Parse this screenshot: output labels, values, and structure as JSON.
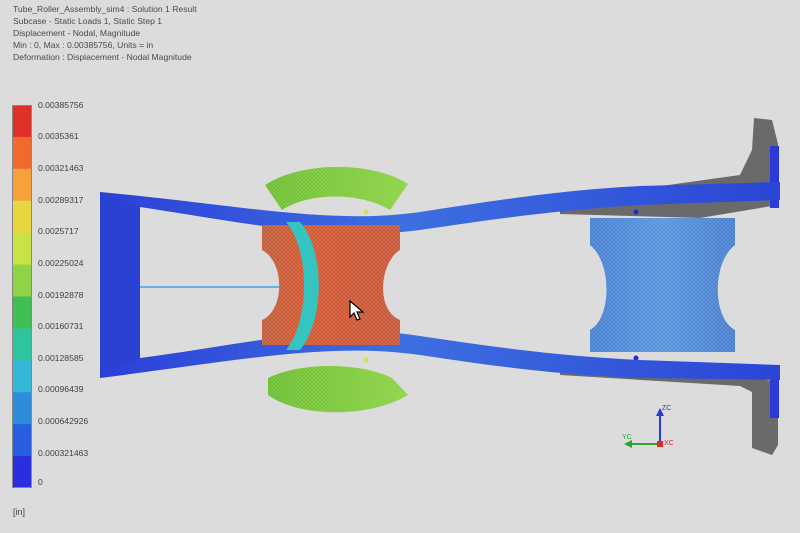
{
  "header": {
    "file_title": "Tube_Roller_Assembly_sim4 : Solution 1 Result",
    "subcase": "Subcase - Static Loads 1, Static Step 1",
    "result_type": "Displacement - Nodal, Magnitude",
    "range": "Min : 0, Max : 0.00385756, Units = in",
    "deformation": "Deformation : Displacement - Nodal Magnitude"
  },
  "legend": {
    "labels": [
      "0.00385756",
      "0.0035361",
      "0.00321463",
      "0.00289317",
      "0.0025717",
      "0.00225024",
      "0.00192878",
      "0.00160731",
      "0.00128585",
      "0.00096439",
      "0.000642926",
      "0.000321463",
      "0"
    ],
    "colors": [
      "#e0302a",
      "#ef6a2c",
      "#f6a23a",
      "#e8d640",
      "#c8e444",
      "#8ed446",
      "#3fbe56",
      "#2fc4a0",
      "#33b8d8",
      "#2d8cdc",
      "#2a5ee0",
      "#2a2ee0"
    ],
    "units": "[in]"
  },
  "triad": {
    "z_label": "ZC",
    "y_label": "YC",
    "x_label": "XC"
  }
}
